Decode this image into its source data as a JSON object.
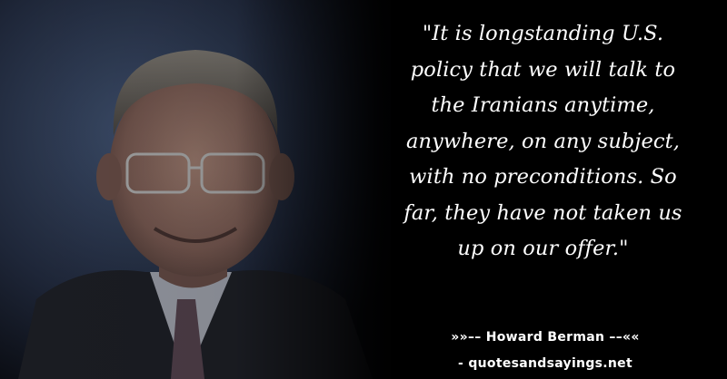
{
  "quote": {
    "lines": [
      "\"It is longstanding U.S.",
      "policy that we will talk to",
      "the Iranians anytime,",
      "anywhere, on any subject,",
      "with no preconditions. So",
      "far, they have not taken us",
      "up on our offer.\""
    ]
  },
  "attribution": {
    "author_line": "»»–– Howard Berman ––««",
    "source_line": "- quotesandsayings.net"
  },
  "colors": {
    "background": "#000000",
    "text": "#ffffff"
  }
}
